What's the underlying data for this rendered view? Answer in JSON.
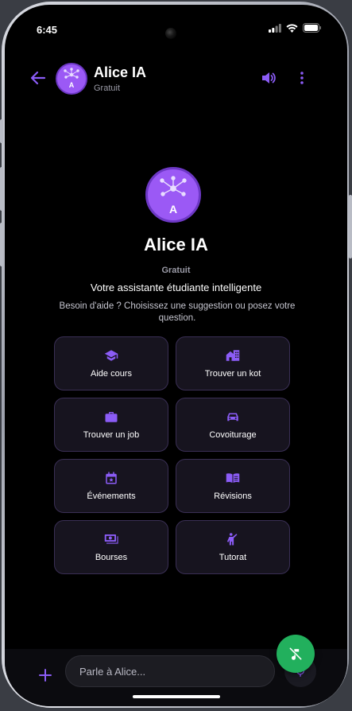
{
  "status_bar": {
    "time": "6:45"
  },
  "header": {
    "title": "Alice IA",
    "subtitle": "Gratuit",
    "avatar_letter": "A"
  },
  "hero": {
    "avatar_letter": "A",
    "title": "Alice IA",
    "plan": "Gratuit",
    "tagline": "Votre assistante étudiante intelligente",
    "help": "Besoin d'aide ? Choisissez une suggestion ou posez votre question."
  },
  "suggestions": [
    {
      "label": "Aide cours",
      "icon": "graduation-cap-icon"
    },
    {
      "label": "Trouver un kot",
      "icon": "building-icon"
    },
    {
      "label": "Trouver un job",
      "icon": "briefcase-icon"
    },
    {
      "label": "Covoiturage",
      "icon": "car-icon"
    },
    {
      "label": "Événements",
      "icon": "calendar-icon"
    },
    {
      "label": "Révisions",
      "icon": "book-icon"
    },
    {
      "label": "Bourses",
      "icon": "money-icon"
    },
    {
      "label": "Tutorat",
      "icon": "teacher-icon"
    }
  ],
  "composer": {
    "placeholder": "Parle à Alice..."
  },
  "colors": {
    "accent": "#8b5cf6",
    "background": "#000000",
    "fab": "#22b05d"
  }
}
